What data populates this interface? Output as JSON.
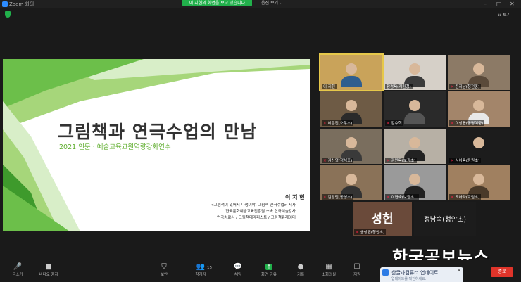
{
  "window": {
    "app_title": "Zoom 회의",
    "controls": [
      "–",
      "□",
      "✕"
    ]
  },
  "top": {
    "share_banner": "이 지현의 화면을 보고 있습니다",
    "view_option": "옵션 보기 ⌄",
    "view_button": "☷ 보기"
  },
  "slide": {
    "title": "그림책과 연극수업의 만남",
    "subtitle": "2021 인문 · 예술교육교원역량강화연수",
    "presenter": "이 지 현",
    "credits": [
      "<그림책이 있어서 다행이야, 그림책 연극수업> 저자",
      "한국문화예술교육진흥원 소속 연극예술강사",
      "연극치료사 / 그림책테라피스트 / 그림책큐레이터"
    ],
    "colors": {
      "light_green": "#a6d67a",
      "mid_green": "#6cbf4a",
      "dark_green": "#3e9a2c",
      "pale_green": "#d8eec8"
    }
  },
  "participants": [
    {
      "name": "이 지현",
      "muted": false,
      "active": true,
      "bg": "#c9a35a",
      "shirt": "#2f5e8e"
    },
    {
      "name": "함경옥(지원청)",
      "muted": false,
      "active": false,
      "bg": "#d6d0c8",
      "shirt": "#3b3b3b"
    },
    {
      "name": "전지남(청현중)",
      "muted": true,
      "active": false,
      "bg": "#8c7a66",
      "shirt": "#5a4a3a"
    },
    {
      "name": "이은진(소우초)",
      "muted": true,
      "active": false,
      "bg": "#6e5b45",
      "shirt": "#2a2a2a"
    },
    {
      "name": "김수희",
      "muted": true,
      "active": false,
      "bg": "#2a2a2a",
      "shirt": "#555555"
    },
    {
      "name": "이성윤(동명여중)",
      "muted": true,
      "active": false,
      "bg": "#a3856a",
      "shirt": "#e8e8e8"
    },
    {
      "name": "김신영(청석중)",
      "muted": true,
      "active": false,
      "bg": "#7a6e5e",
      "shirt": "#3a3a3a"
    },
    {
      "name": "김민옥(보광초)",
      "muted": true,
      "active": false,
      "bg": "#b7b0a5",
      "shirt": "#222222"
    },
    {
      "name": "서아름(동원초)",
      "muted": true,
      "active": false,
      "bg": "#1c1c1c",
      "shirt": "#1c1c1c"
    },
    {
      "name": "김경민(동성초)",
      "muted": true,
      "active": false,
      "bg": "#8a7258",
      "shirt": "#333333"
    },
    {
      "name": "이현숙(보광초...",
      "muted": true,
      "active": false,
      "bg": "#9a9a9a",
      "shirt": "#222222"
    },
    {
      "name": "조아라(교림초)",
      "muted": true,
      "active": false,
      "bg": "#a08060",
      "shirt": "#4a3a2a"
    }
  ],
  "name_tiles": [
    {
      "big_text": "성헌",
      "label": "송성원(청안초)"
    },
    {
      "name_text": "정남숙(청안초)"
    }
  ],
  "toolbar": {
    "participant_count": "15",
    "buttons": [
      {
        "icon": "🎤",
        "label": "음소거"
      },
      {
        "icon": "■",
        "label": "비디오 중지"
      },
      {
        "icon": "⛉",
        "label": "보안"
      },
      {
        "icon": "👥",
        "label": "참가자"
      },
      {
        "icon": "💬",
        "label": "채팅"
      },
      {
        "icon": "↑",
        "label": "화면 공유"
      },
      {
        "icon": "●",
        "label": "기록"
      },
      {
        "icon": "▦",
        "label": "소회의실"
      },
      {
        "icon": "☐",
        "label": "지원"
      }
    ],
    "end_label": "종료"
  },
  "toast": {
    "title": "한글과컴퓨터 업데이트",
    "subtitle": "업데이트를 확인하세요.",
    "close": "✕"
  },
  "watermark": "한국공보뉴스"
}
